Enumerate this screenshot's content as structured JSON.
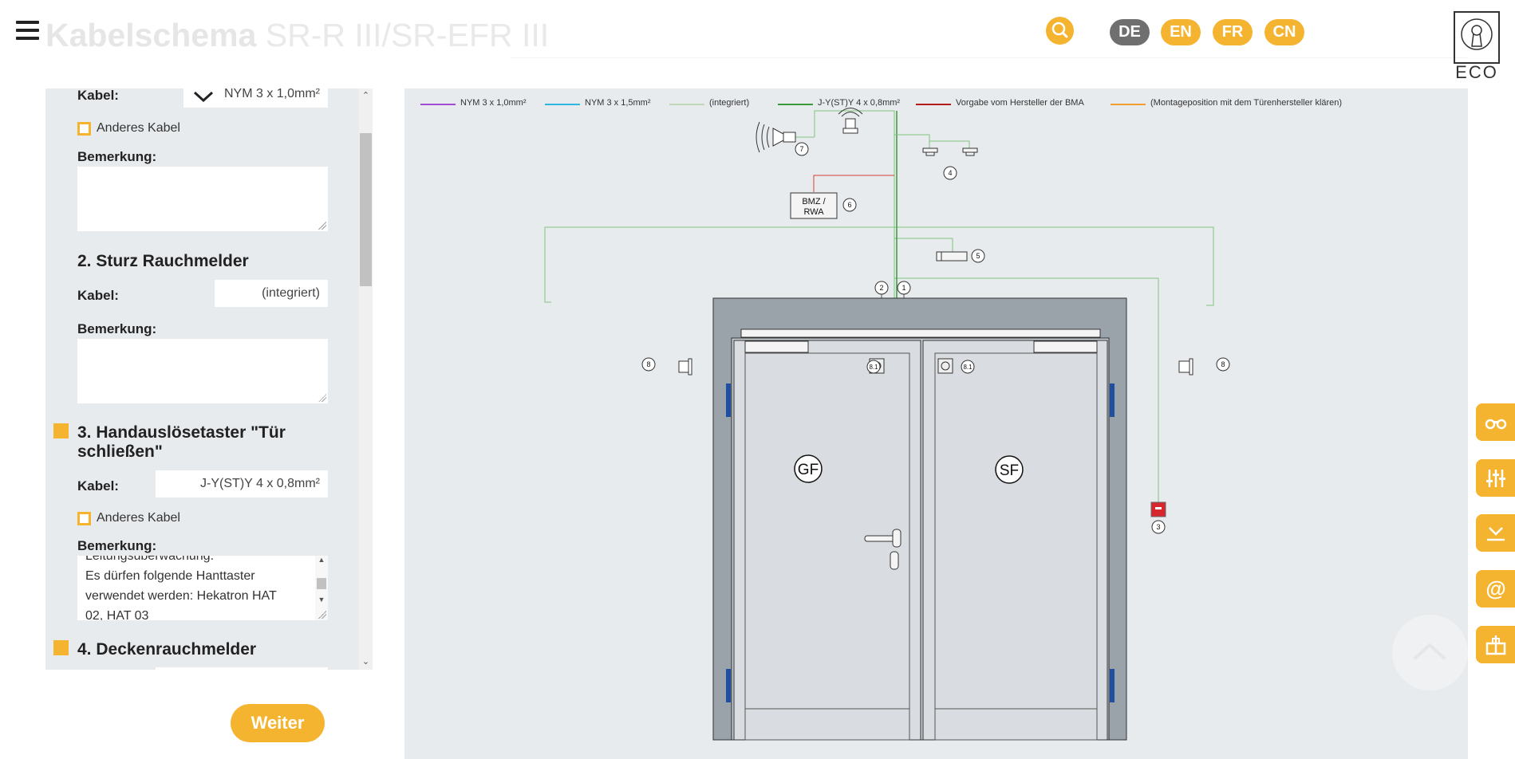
{
  "header": {
    "title_bold": "Kabelschema",
    "title_light": "SR-R III/SR-EFR III",
    "languages": [
      "DE",
      "EN",
      "FR",
      "CN"
    ],
    "active_language": "DE",
    "logo_text": "ECO"
  },
  "form": {
    "kabel_label": "Kabel:",
    "bemerkung_label": "Bemerkung:",
    "anderes_kabel_label": "Anderes Kabel",
    "item1": {
      "kabel_value": "NYM 3 x 1,0mm²",
      "bemerkung": ""
    },
    "item2": {
      "title": "2. Sturz Rauchmelder",
      "kabel_value": "(integriert)",
      "bemerkung": ""
    },
    "item3": {
      "title_line1": "3. Handauslösetaster \"Tür",
      "title_line2": "schließen\"",
      "kabel_value": "J-Y(ST)Y 4 x 0,8mm²",
      "bemerkung_lines": [
        "Leitungsüberwachung.",
        "Es dürfen folgende Hanttaster",
        "verwendet werden: Hekatron HAT",
        "02, HAT 03"
      ]
    },
    "item4": {
      "title": "4. Deckenrauchmelder"
    },
    "weiter_label": "Weiter"
  },
  "legend": [
    {
      "label": "NYM 3 x 1,0mm²",
      "color": "#a24bd1"
    },
    {
      "label": "NYM 3 x 1,5mm²",
      "color": "#2fb6e0"
    },
    {
      "label": "(integriert)",
      "color": "#c2d6b8"
    },
    {
      "label": "J-Y(ST)Y 4 x 0,8mm²",
      "color": "#3a9a3a"
    },
    {
      "label": "Vorgabe vom Hersteller der BMA",
      "color": "#b31b1b"
    },
    {
      "label": "(Montageposition mit dem Türenhersteller klären)",
      "color": "#f0a030"
    }
  ],
  "diagram": {
    "bmz_line1": "BMZ /",
    "bmz_line2": "RWA",
    "leaf_left": "GF",
    "leaf_right": "SF",
    "callouts": [
      "1",
      "2",
      "3",
      "4",
      "5",
      "6",
      "7",
      "8",
      "8",
      "8.1",
      "8.1"
    ]
  },
  "tools": [
    "binoculars-icon",
    "sliders-icon",
    "download-icon",
    "at-icon",
    "share-icon"
  ]
}
